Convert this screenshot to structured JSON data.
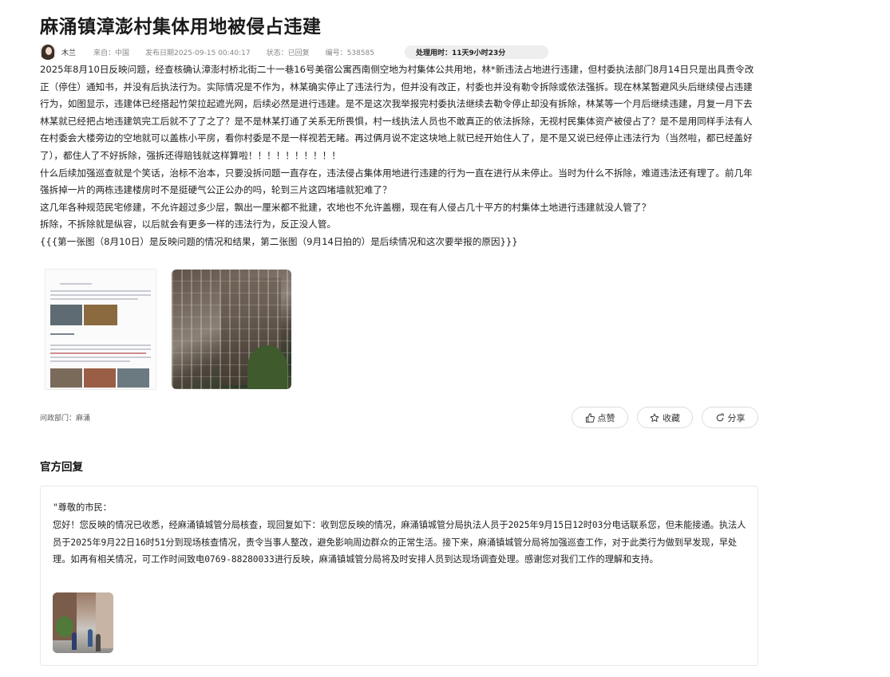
{
  "page": {
    "title": "麻涌镇漳澎村集体用地被侵占违建"
  },
  "meta": {
    "author": "木兰",
    "source": "来自：中国",
    "publish_date": "发布日期2025-09-15 00:40:17",
    "status": "状态：已回复",
    "number": "编号：538585",
    "handling_time": "处理用时：11天9小时23分"
  },
  "content": {
    "paragraphs": [
      "2025年8月10日反映问题，经查核确认漳澎村桥北街二十一巷16号美宿公寓西南侧空地为村集体公共用地，林*新违法占地进行违建，但村委执法部门8月14日只是出具责令改正（停住）通知书，并没有后执法行为。实际情况是不作为，林某确实停止了违法行为，但并没有改正，村委也并没有勒令拆除或依法强拆。现在林某暂避风头后继续侵占违建行为，如图显示，违建体已经搭起竹架拉起遮光网，后续必然是进行违建。是不是这次我举报完村委执法继续去勒令停止却没有拆除，林某等一个月后继续违建，月复一月下去林某就已经把占地违建筑完工后就不了了之了？是不是林某打通了关系无所畏惧，村一线执法人员也不敢真正的依法拆除，无视村民集体资产被侵占了？是不是用同样手法有人在村委会大楼旁边的空地就可以盖栋小平房，看你村委是不是一样视若无睹。再过俩月说不定这块地上就已经开始住人了，是不是又说已经停止违法行为（当然啦，都已经盖好了），都住人了不好拆除，强拆还得赔钱就这样算啦！！！！！！！！！！",
      "什么后续加强巡查就是个笑话，治标不治本，只要没拆问题一直存在，违法侵占集体用地进行违建的行为一直在进行从未停止。当时为什么不拆除，难道违法还有理了。前几年强拆掉一片的两栋违建楼房时不是挺硬气公正公办的吗，轮到三片这四堵墙就犯难了？",
      "这几年各种规范民宅修建，不允许超过多少层，飘出一厘米都不批建，农地也不允许盖棚，现在有人侵占几十平方的村集体土地进行违建就没人管了？",
      "拆除，不拆除就是纵容，以后就会有更多一样的违法行为，反正没人管。",
      "{{{第一张图（8月10日）是反映问题的情况和结果，第二张图（9月14日拍的）是后续情况和这次要举报的原因}}}"
    ]
  },
  "footer": {
    "dept": "问政部门：麻涌",
    "like_label": "点赞",
    "collect_label": "收藏",
    "share_label": "分享"
  },
  "reply": {
    "section_title": "官方回复",
    "text": "\"尊敬的市民：\n您好！您反映的情况已收悉，经麻涌镇城管分局核查，现回复如下：收到您反映的情况，麻涌镇城管分局执法人员于2025年9月15日12时03分电话联系您，但未能接通。执法人员于2025年9月22日16时51分到现场核查情况，责令当事人整改，避免影响周边群众的正常生活。接下来，麻涌镇城管分局将加强巡查工作，对于此类行为做到早发现，早处理。如再有相关情况，可工作时间致电0769-88280033进行反映，麻涌镇城管分局将及时安排人员到达现场调查处理。感谢您对我们工作的理解和支持。"
  }
}
